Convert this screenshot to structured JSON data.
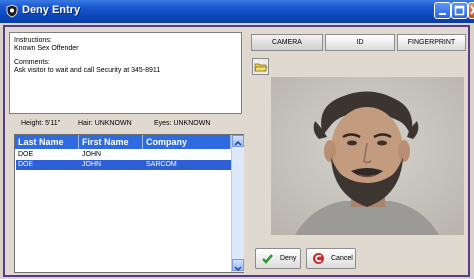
{
  "window": {
    "title": "Deny Entry"
  },
  "notes": {
    "instructions_label": "Instructions:",
    "instructions_text": "Known Sex Offender",
    "comments_label": "Comments:",
    "comments_text": "Ask visitor to wait and call Security at 345-8911"
  },
  "stats": {
    "height": "Height: 5'11\"",
    "hair": "Hair: UNKNOWN",
    "eyes": "Eyes: UNKNOWN"
  },
  "grid": {
    "columns": [
      "Last Name",
      "First Name",
      "Company"
    ],
    "rows": [
      {
        "last": "DOE",
        "first": "JOHN",
        "company": ""
      },
      {
        "last": "DOE",
        "first": "JOHN",
        "company": "SARCOM"
      }
    ],
    "selected_row": 1
  },
  "tabs": [
    "CAMERA",
    "ID",
    "FINGERPRINT"
  ],
  "buttons": {
    "deny": "Deny",
    "cancel": "Cancel"
  },
  "icons": {
    "app": "shield-icon",
    "minimize": "minimize-icon",
    "maximize": "maximize-icon",
    "close": "close-icon",
    "folder": "folder-icon",
    "deny": "checkmark-icon",
    "cancel": "cancel-icon"
  },
  "colors": {
    "title_bar": "#0b46bb",
    "grid_header": "#2f6be0",
    "selected_row": "#2d5fd6",
    "frame_border": "#5a3a86"
  }
}
